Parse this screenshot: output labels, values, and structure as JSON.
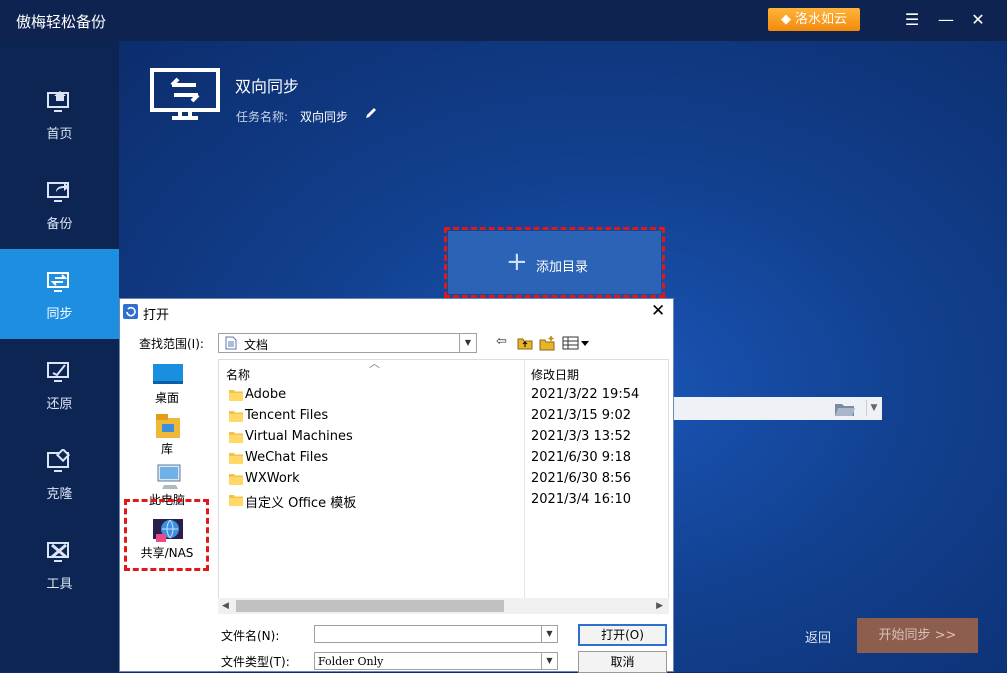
{
  "app": {
    "title": "傲梅轻松备份",
    "upgrade_label": "洛水如云"
  },
  "sidebar": {
    "items": [
      {
        "label": "首页",
        "icon": "home-monitor-icon"
      },
      {
        "label": "备份",
        "icon": "backup-monitor-icon"
      },
      {
        "label": "同步",
        "icon": "sync-monitor-icon",
        "active": true
      },
      {
        "label": "还原",
        "icon": "restore-monitor-icon"
      },
      {
        "label": "克隆",
        "icon": "clone-monitor-icon"
      },
      {
        "label": "工具",
        "icon": "tools-icon"
      }
    ]
  },
  "task": {
    "title": "双向同步",
    "name_label": "任务名称:",
    "name": "双向同步"
  },
  "add_directory": {
    "label": "添加目录"
  },
  "footer": {
    "back_label": "返回",
    "start_label": "开始同步 >>"
  },
  "dialog": {
    "title": "打开",
    "look_in_label": "查找范围(I):",
    "look_in_value": "文档",
    "places": [
      {
        "label": "桌面"
      },
      {
        "label": "库"
      },
      {
        "label": "此电脑"
      },
      {
        "label": "共享/NAS"
      }
    ],
    "columns": {
      "name": "名称",
      "modified": "修改日期"
    },
    "files": [
      {
        "name": "Adobe",
        "modified": "2021/3/22 19:54"
      },
      {
        "name": "Tencent Files",
        "modified": "2021/3/15 9:02"
      },
      {
        "name": "Virtual Machines",
        "modified": "2021/3/3 13:52"
      },
      {
        "name": "WeChat Files",
        "modified": "2021/6/30 9:18"
      },
      {
        "name": "WXWork",
        "modified": "2021/6/30 8:56"
      },
      {
        "name": "自定义 Office 模板",
        "modified": "2021/3/4 16:10"
      }
    ],
    "filename_label": "文件名(N):",
    "filename_value": "",
    "filetype_label": "文件类型(T):",
    "filetype_value": "Folder Only",
    "open_label": "打开(O)",
    "cancel_label": "取消"
  },
  "colors": {
    "accent": "#1e8ee0",
    "sidebar_bg": "#0d2553",
    "upgrade": "#f7a01e",
    "highlight_dash": "#e01818"
  }
}
